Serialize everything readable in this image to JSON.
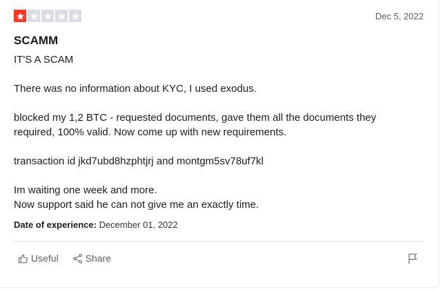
{
  "review": {
    "rating": 1,
    "max_rating": 5,
    "rating_color": "#ff3722",
    "empty_star_color": "#dcdce6",
    "date": "Dec 5, 2022",
    "title": "SCAMM",
    "paragraphs": [
      "IT'S A SCAM",
      "There was no information about KYC, I used exodus.",
      "blocked my 1,2 BTC - requested documents, gave them all the documents they required, 100% valid. Now come up with new requirements.",
      "transaction id jkd7ubd8hzphtjrj and montgm5sv78uf7kl",
      "Im waiting one week and more.\nNow support said he can not give me an exactly time."
    ],
    "experience_label": "Date of experience:",
    "experience_date": "December 01, 2022"
  },
  "actions": {
    "useful_label": "Useful",
    "useful_icon": "thumbs-up-icon",
    "share_label": "Share",
    "share_icon": "share-icon",
    "flag_icon": "flag-icon"
  }
}
